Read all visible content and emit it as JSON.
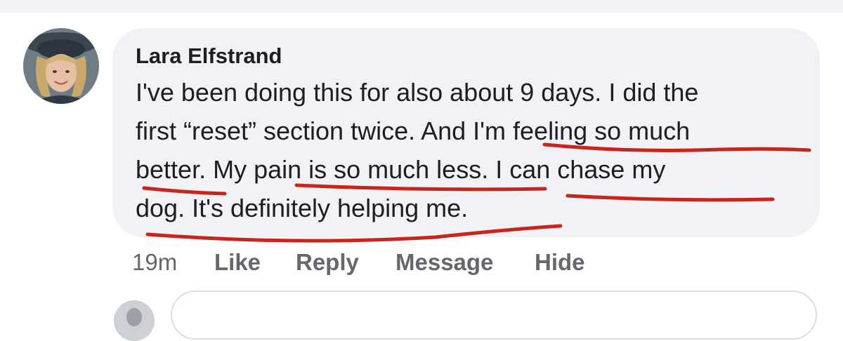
{
  "comment": {
    "author": "Lara Elfstrand",
    "lines": [
      "I've been doing this for also about 9 days. I did the",
      "first “reset” section twice. And I'm feeling so much",
      "better. My pain is so much less. I can chase my",
      "dog. It's definitely helping me."
    ]
  },
  "actions": {
    "time": "19m",
    "like": "Like",
    "reply": "Reply",
    "message": "Message",
    "hide": "Hide"
  },
  "colors": {
    "bubble": "#f0f2f5",
    "text": "#1c1e21",
    "secondary": "#65676b",
    "annotation_underline": "#c8261c"
  }
}
